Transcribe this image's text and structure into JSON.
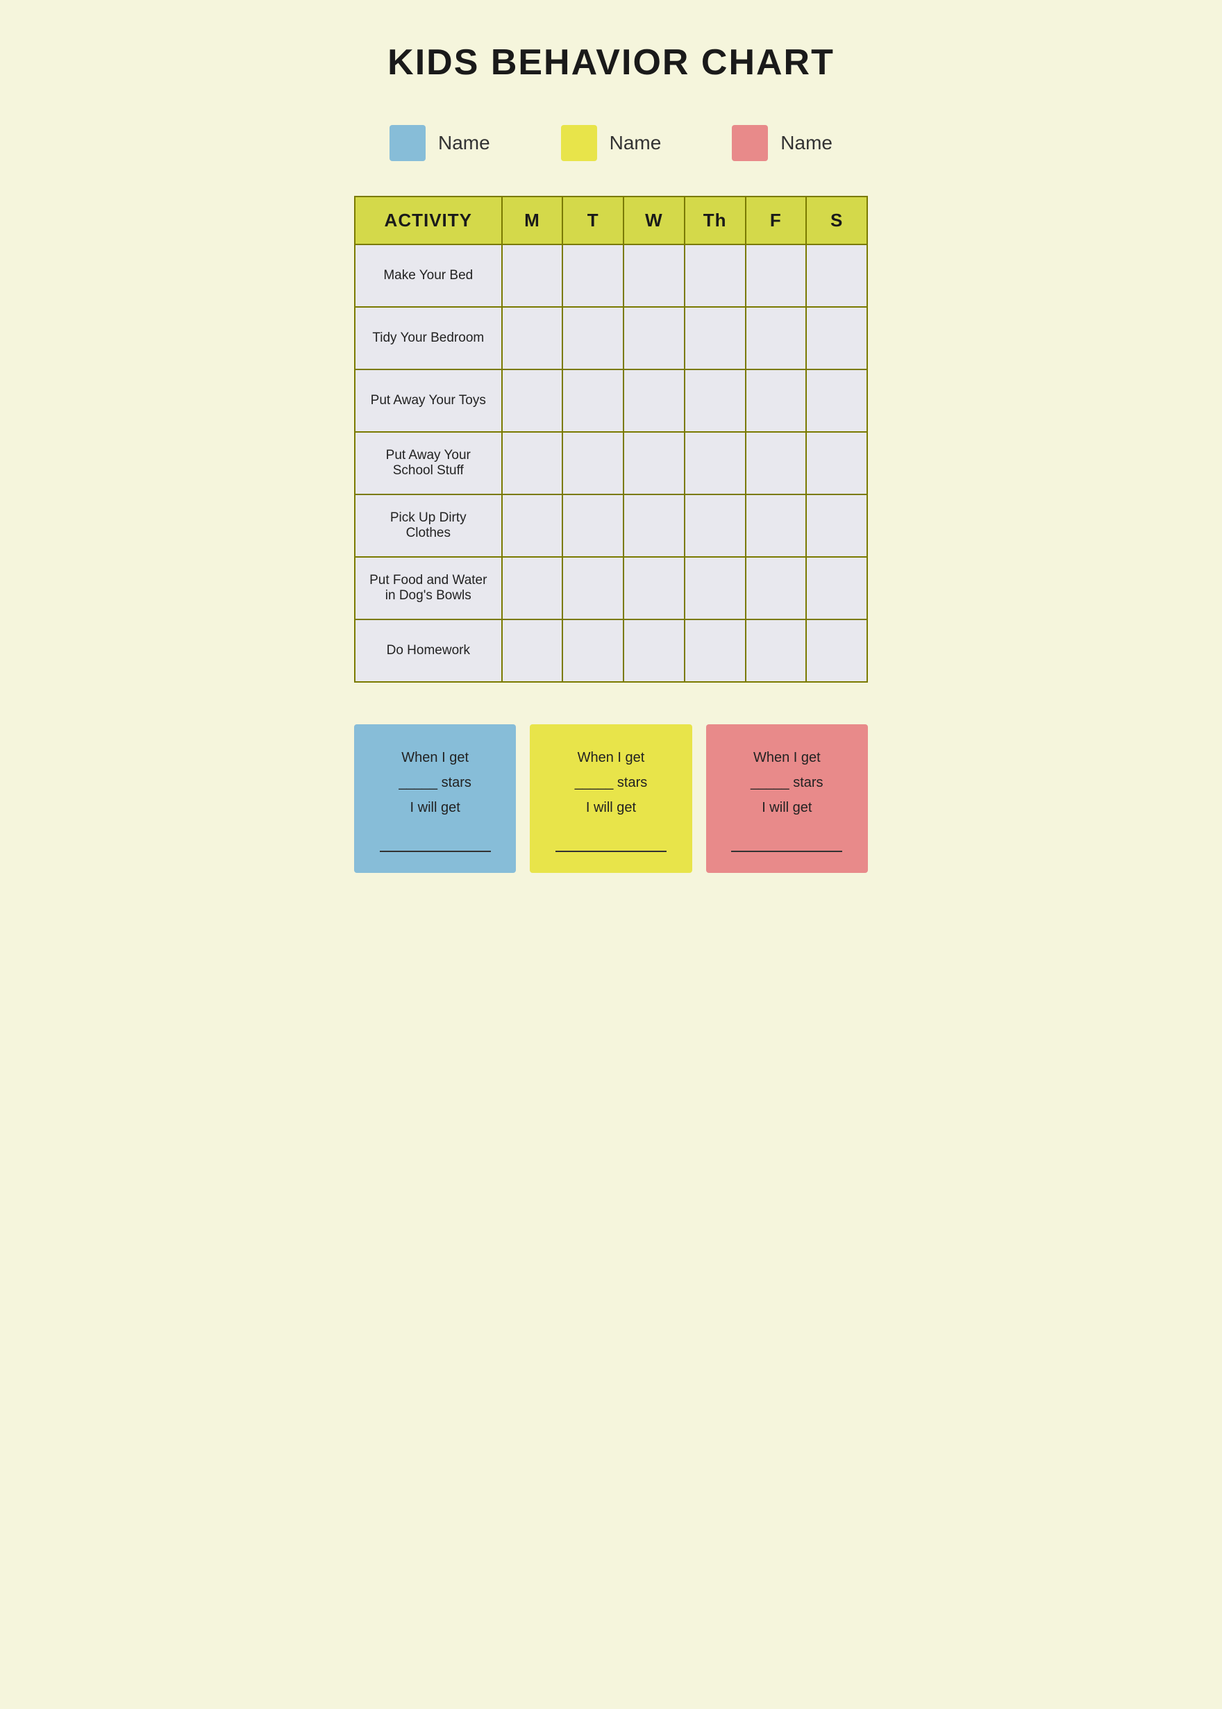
{
  "title": "KIDS BEHAVIOR CHART",
  "legend": [
    {
      "id": "blue",
      "color": "#87bdd8",
      "label": "Name"
    },
    {
      "id": "yellow",
      "color": "#e8e44a",
      "label": "Name"
    },
    {
      "id": "pink",
      "color": "#e88a8a",
      "label": "Name"
    }
  ],
  "table": {
    "header": {
      "activity_col": "ACTIVITY",
      "days": [
        "M",
        "T",
        "W",
        "Th",
        "F",
        "S"
      ]
    },
    "rows": [
      {
        "activity": "Make Your Bed"
      },
      {
        "activity": "Tidy Your Bedroom"
      },
      {
        "activity": "Put Away Your Toys"
      },
      {
        "activity": "Put Away Your School Stuff"
      },
      {
        "activity": "Pick Up Dirty Clothes"
      },
      {
        "activity": "Put Food and Water in Dog's Bowls"
      },
      {
        "activity": "Do Homework"
      }
    ]
  },
  "rewards": [
    {
      "id": "blue",
      "color": "#87bdd8",
      "line1": "When I get",
      "line2": "_____ stars",
      "line3": "I will get",
      "line4": "_______________"
    },
    {
      "id": "yellow",
      "color": "#e8e44a",
      "line1": "When I get",
      "line2": "_____ stars",
      "line3": "I will get",
      "line4": "_______________"
    },
    {
      "id": "pink",
      "color": "#e88a8a",
      "line1": "When I get",
      "line2": "_____ stars",
      "line3": "I will get",
      "line4": "_______________"
    }
  ]
}
